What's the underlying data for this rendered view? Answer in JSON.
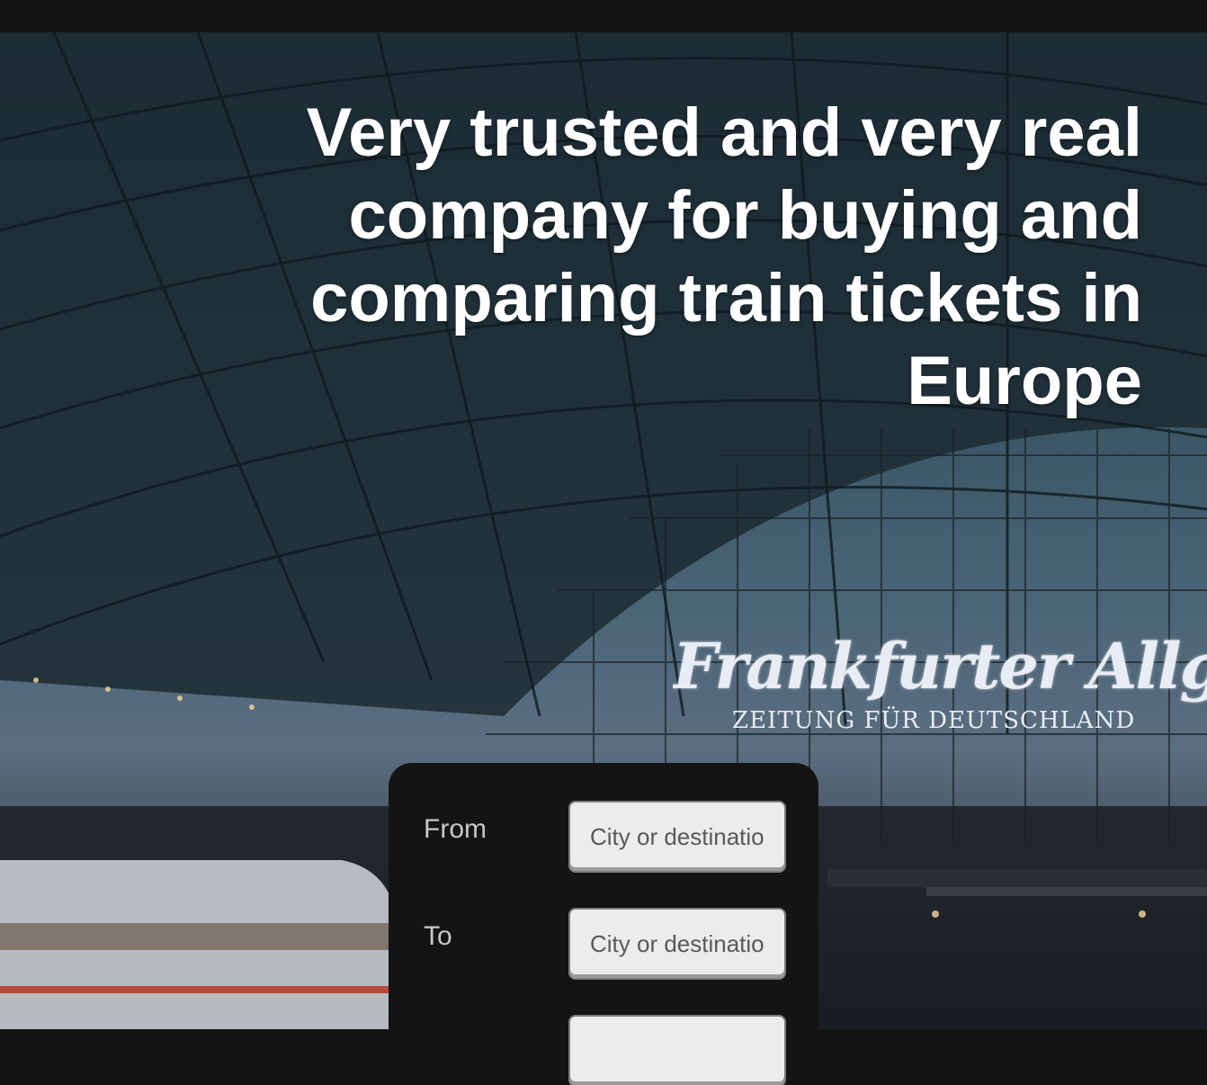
{
  "hero": {
    "headline": "Very trusted and very real company for buying and comparing train tickets in Europe",
    "sign_title": "Frankfurter Allgemeine",
    "sign_subtitle": "ZEITUNG FÜR DEUTSCHLAND"
  },
  "search": {
    "from_label": "From",
    "from_placeholder": "City or destination",
    "to_label": "To",
    "to_placeholder": "City or destination",
    "third_placeholder": ""
  },
  "colors": {
    "topbar": "#141414",
    "panel": "#141414",
    "input_bg": "#ececec",
    "headline_text": "#ffffff"
  }
}
